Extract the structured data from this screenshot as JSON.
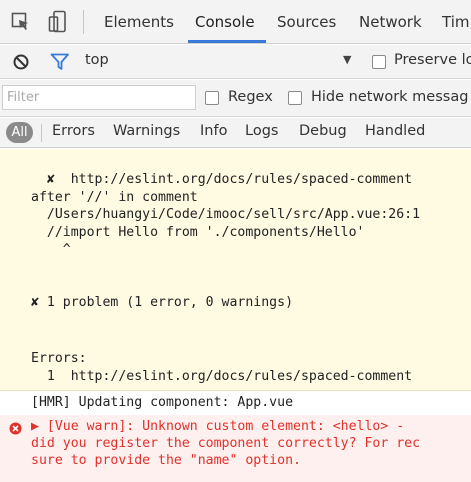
{
  "tabs": [
    "Elements",
    "Console",
    "Sources",
    "Network",
    "Tim"
  ],
  "active_tab": "Console",
  "toolbar": {
    "context": "top",
    "preserve_log": "Preserve lo"
  },
  "filter": {
    "placeholder": "Filter",
    "regex": "Regex",
    "hide_network": "Hide network messag"
  },
  "levels": {
    "all": "All",
    "items": [
      "Errors",
      "Warnings",
      "Info",
      "Logs",
      "Debug",
      "Handled"
    ]
  },
  "console": {
    "line1": "  ✘  http://eslint.org/docs/rules/spaced-comment",
    "line2": "after '//' in comment",
    "line3": "  /Users/huangyi/Code/imooc/sell/src/App.vue:26:1",
    "line4": "  //import Hello from './components/Hello'",
    "line5": "    ^",
    "line6": "✘ 1 problem (1 error, 0 warnings)",
    "line7": "Errors:",
    "line8": "  1  http://eslint.org/docs/rules/spaced-comment",
    "hmr": "[HMR] Updating component: App.vue",
    "warn1": "▶ [Vue warn]: Unknown custom element: <hello> -",
    "warn2": "did you register the component correctly? For rec",
    "warn3": "sure to provide the \"name\" option."
  },
  "colors": {
    "console_bg": "#fffbe3",
    "error_red": "#e0312b",
    "accent_blue": "#3879d9"
  }
}
